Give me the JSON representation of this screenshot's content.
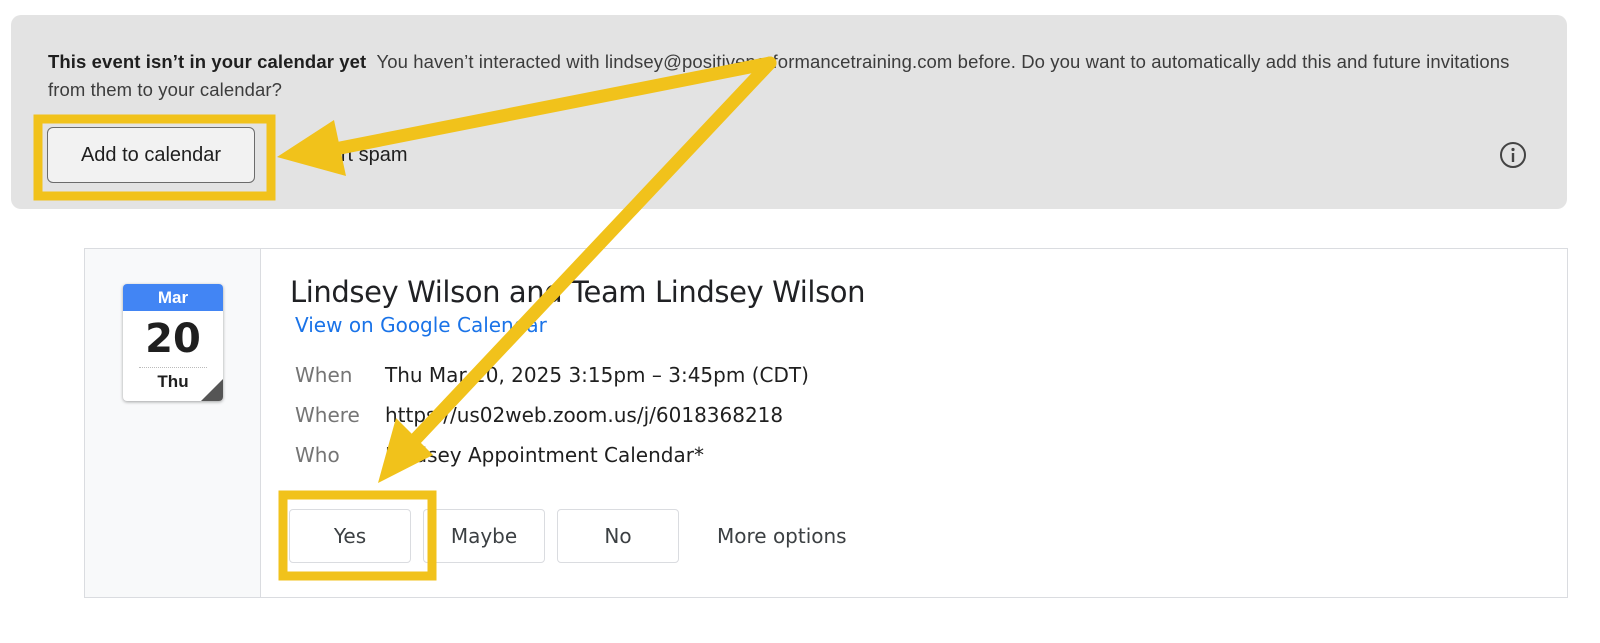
{
  "banner": {
    "lead": "This event isn’t in your calendar yet",
    "message": "You haven’t interacted with lindsey@positiveperformancetraining.com before. Do you want to automatically add this and future invitations from them to your calendar?",
    "add_button": "Add to calendar",
    "spam_button": "Report spam",
    "info_icon": "info-icon"
  },
  "event": {
    "calendar_icon": {
      "month": "Mar",
      "day": "20",
      "weekday": "Thu"
    },
    "title": "Lindsey Wilson and Team Lindsey Wilson",
    "view_link": "View on Google Calendar",
    "details": [
      {
        "label": "When",
        "value": "Thu Mar 20, 2025 3:15pm – 3:45pm (CDT)"
      },
      {
        "label": "Where",
        "value": "https://us02web.zoom.us/j/6018368218"
      },
      {
        "label": "Who",
        "value": "Lindsey Appointment Calendar*"
      }
    ],
    "rsvp": {
      "yes": "Yes",
      "maybe": "Maybe",
      "no": "No",
      "more": "More options"
    }
  },
  "annotation": {
    "highlight_color": "#f1c21b"
  }
}
